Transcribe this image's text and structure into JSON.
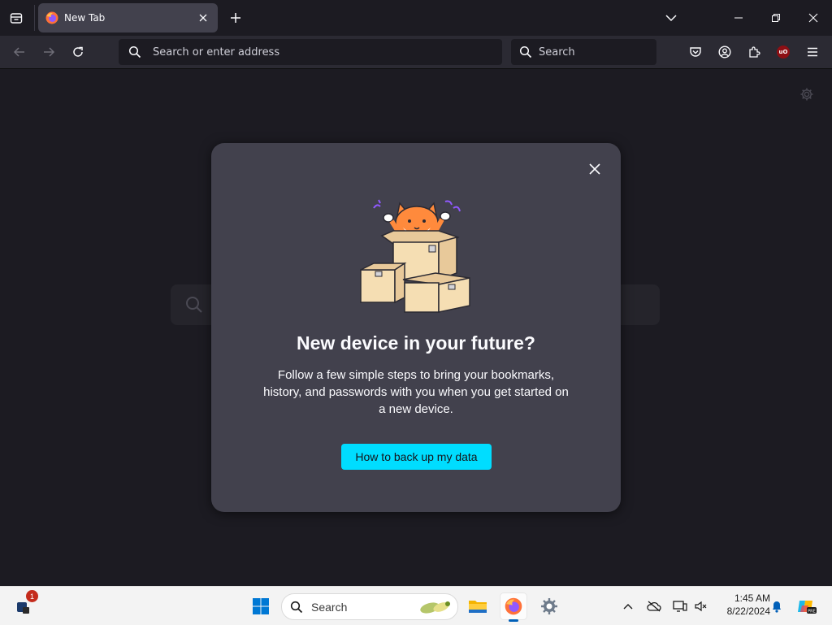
{
  "browser": {
    "tab": {
      "title": "New Tab"
    },
    "urlbar": {
      "placeholder": "Search or enter address"
    },
    "searchbar": {
      "placeholder": "Search"
    }
  },
  "modal": {
    "heading": "New device in your future?",
    "body": "Follow a few simple steps to bring your bookmarks, history, and passwords with you when you get started on a new device.",
    "cta_label": "How to back up my data"
  },
  "taskbar": {
    "search_placeholder": "Search",
    "notification_count": "1",
    "time": "1:45 AM",
    "date": "8/22/2024"
  },
  "colors": {
    "accent": "#00ddff",
    "chrome_bg": "#1c1b22",
    "toolbar_bg": "#2b2a33",
    "modal_bg": "#42414d"
  }
}
